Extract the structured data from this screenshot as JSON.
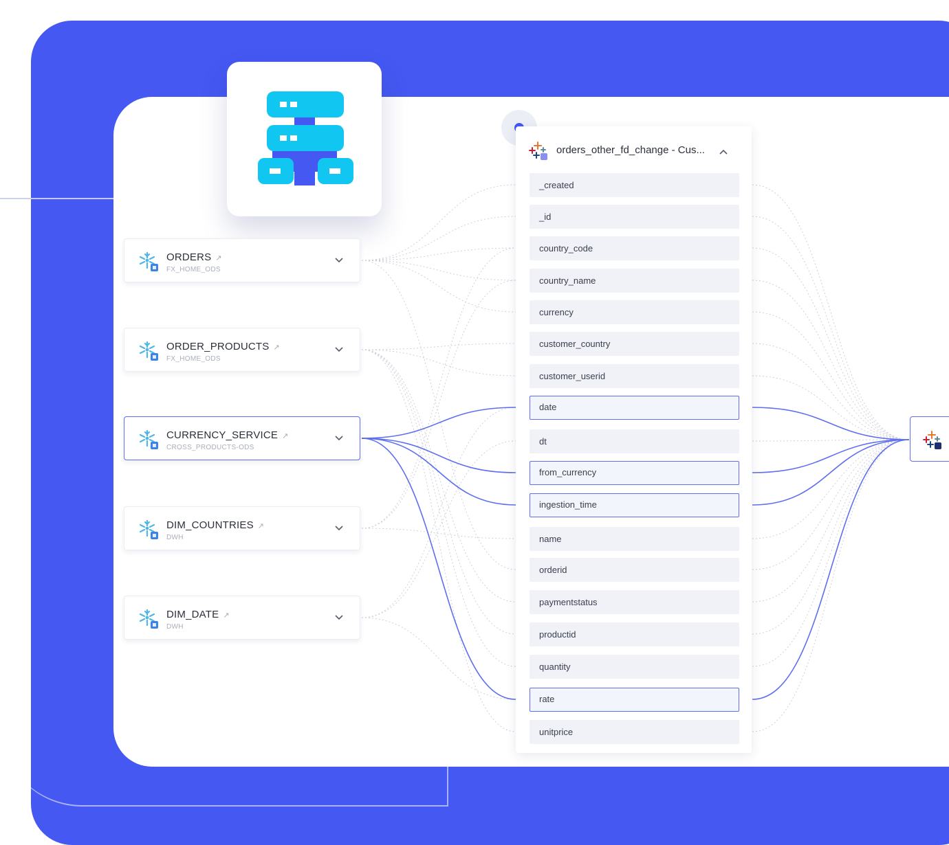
{
  "colors": {
    "background": "#4558f2",
    "accent": "#5e6ef0",
    "logo_cyan": "#12c6f2",
    "logo_blue": "#4558f2"
  },
  "logo": {
    "icon": "server-hierarchy-icon"
  },
  "sources": [
    {
      "name": "ORDERS",
      "schema": "FX_HOME_ODS",
      "icon": "snowflake-icon",
      "active": false
    },
    {
      "name": "ORDER_PRODUCTS",
      "schema": "FX_HOME_ODS",
      "icon": "snowflake-icon",
      "active": false
    },
    {
      "name": "CURRENCY_SERVICE",
      "schema": "CROSS_PRODUCTS-ODS",
      "icon": "snowflake-icon",
      "active": true
    },
    {
      "name": "DIM_COUNTRIES",
      "schema": "DWH",
      "icon": "snowflake-icon",
      "active": false
    },
    {
      "name": "DIM_DATE",
      "schema": "DWH",
      "icon": "snowflake-icon",
      "active": false
    }
  ],
  "table": {
    "title": "orders_other_fd_change - Cus...",
    "icon": "tableau-icon",
    "columns": [
      {
        "name": "_created",
        "highlighted": false
      },
      {
        "name": "_id",
        "highlighted": false
      },
      {
        "name": "country_code",
        "highlighted": false
      },
      {
        "name": "country_name",
        "highlighted": false
      },
      {
        "name": "currency",
        "highlighted": false
      },
      {
        "name": "customer_country",
        "highlighted": false
      },
      {
        "name": "customer_userid",
        "highlighted": false
      },
      {
        "name": "date",
        "highlighted": true
      },
      {
        "name": "dt",
        "highlighted": false
      },
      {
        "name": "from_currency",
        "highlighted": true
      },
      {
        "name": "ingestion_time",
        "highlighted": true
      },
      {
        "name": "name",
        "highlighted": false
      },
      {
        "name": "orderid",
        "highlighted": false
      },
      {
        "name": "paymentstatus",
        "highlighted": false
      },
      {
        "name": "productid",
        "highlighted": false
      },
      {
        "name": "quantity",
        "highlighted": false
      },
      {
        "name": "rate",
        "highlighted": true
      },
      {
        "name": "unitprice",
        "highlighted": false
      }
    ]
  },
  "target": {
    "icon": "tableau-icon"
  }
}
